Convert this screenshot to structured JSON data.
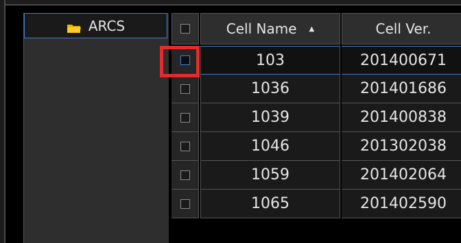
{
  "tree": {
    "items": [
      {
        "label": "ARCS",
        "icon": "folder-icon"
      }
    ]
  },
  "table": {
    "columns": [
      "Cell Name",
      "Cell Ver."
    ],
    "sort": {
      "column": "Cell Name",
      "direction": "ascending"
    },
    "rows": [
      {
        "name": "103",
        "version": "201400671",
        "checked": false,
        "selected": true
      },
      {
        "name": "1036",
        "version": "201401686",
        "checked": false,
        "selected": false
      },
      {
        "name": "1039",
        "version": "201400838",
        "checked": false,
        "selected": false
      },
      {
        "name": "1046",
        "version": "201302038",
        "checked": false,
        "selected": false
      },
      {
        "name": "1059",
        "version": "201402064",
        "checked": false,
        "selected": false
      },
      {
        "name": "1065",
        "version": "201402590",
        "checked": false,
        "selected": false
      }
    ]
  },
  "colors": {
    "accent": "#3d7ed6",
    "highlight": "#e52b2b",
    "folder": "#f0b400"
  }
}
